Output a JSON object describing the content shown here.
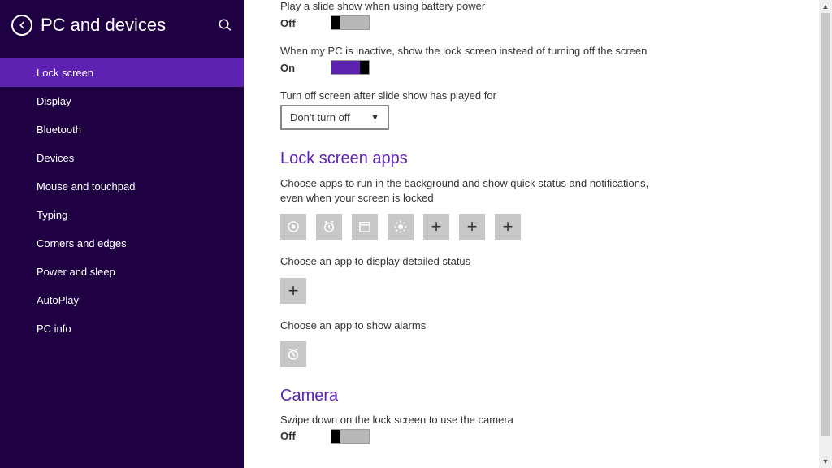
{
  "sidebar": {
    "title": "PC and devices",
    "items": [
      {
        "label": "Lock screen",
        "active": true
      },
      {
        "label": "Display"
      },
      {
        "label": "Bluetooth"
      },
      {
        "label": "Devices"
      },
      {
        "label": "Mouse and touchpad"
      },
      {
        "label": "Typing"
      },
      {
        "label": "Corners and edges"
      },
      {
        "label": "Power and sleep"
      },
      {
        "label": "AutoPlay"
      },
      {
        "label": "PC info"
      }
    ]
  },
  "settings": {
    "slideshow_battery": {
      "label": "Play a slide show when using battery power",
      "state": "Off"
    },
    "inactive_lock": {
      "label": "When my PC is inactive, show the lock screen instead of turning off the screen",
      "state": "On"
    },
    "turnoff_after": {
      "label": "Turn off screen after slide show has played for",
      "value": "Don't turn off"
    }
  },
  "lockapps": {
    "heading": "Lock screen apps",
    "quick_help": "Choose apps to run in the background and show quick status and notifications, even when your screen is locked",
    "detailed_help": "Choose an app to display detailed status",
    "alarms_help": "Choose an app to show alarms"
  },
  "camera": {
    "heading": "Camera",
    "swipe": {
      "label": "Swipe down on the lock screen to use the camera",
      "state": "Off"
    }
  }
}
